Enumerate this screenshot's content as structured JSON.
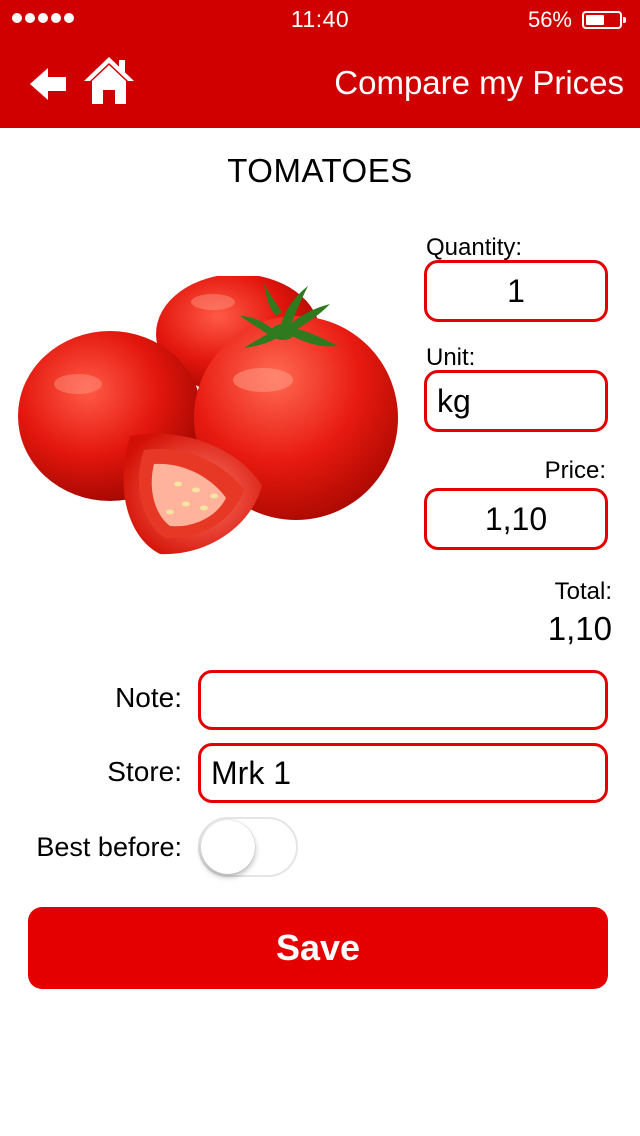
{
  "status_bar": {
    "signal_dots": 5,
    "time": "11:40",
    "battery_percent": "56%",
    "battery_level": 0.56
  },
  "nav": {
    "back_icon": "back-arrow-icon",
    "home_icon": "home-icon",
    "title": "Compare my Prices"
  },
  "product": {
    "name": "TOMATOES",
    "image": "tomatoes-photo"
  },
  "form": {
    "quantity_label": "Quantity:",
    "quantity_value": "1",
    "unit_label": "Unit:",
    "unit_value": "kg",
    "price_label": "Price:",
    "price_value": "1,10",
    "total_label": "Total:",
    "total_value": "1,10",
    "note_label": "Note:",
    "note_value": "",
    "store_label": "Store:",
    "store_value": "Mrk 1",
    "best_before_label": "Best before:",
    "best_before_on": false
  },
  "actions": {
    "save_label": "Save"
  },
  "colors": {
    "brand_red": "#d10000",
    "field_border": "#e40000",
    "button_red": "#e40000"
  }
}
